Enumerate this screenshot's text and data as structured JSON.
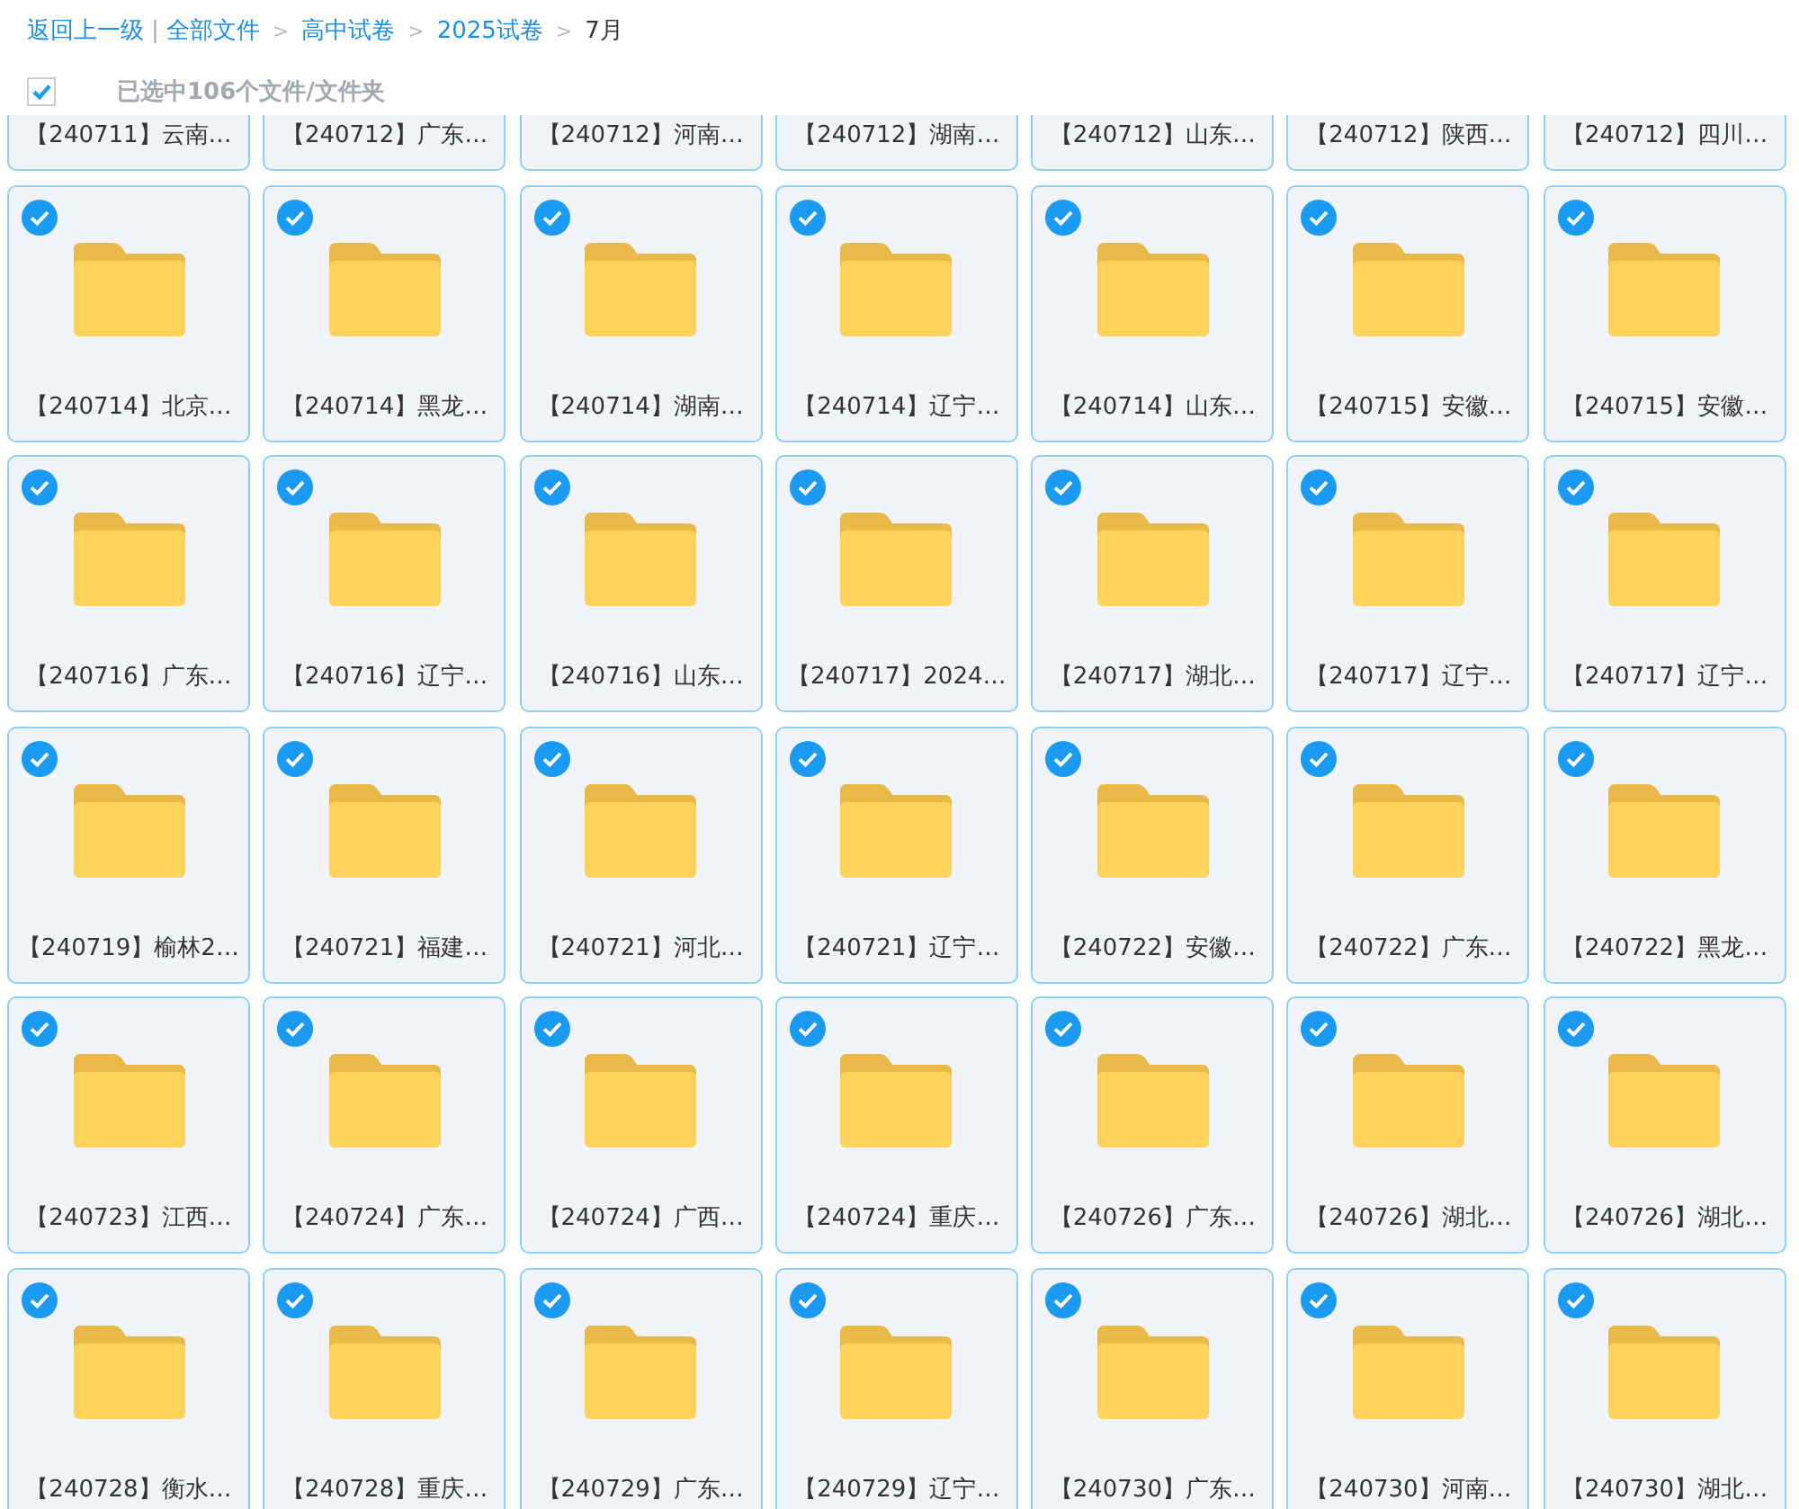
{
  "breadcrumb": {
    "back": "返回上一级",
    "separator": "|",
    "items": [
      {
        "label": "全部文件",
        "current": false
      },
      {
        "label": "高中试卷",
        "current": false
      },
      {
        "label": "2025试卷",
        "current": false
      },
      {
        "label": "7月",
        "current": true
      }
    ],
    "arrow": ">"
  },
  "selection_bar": {
    "checked": true,
    "label": "已选中106个文件/文件夹"
  },
  "files": [
    {
      "name": "【240711】云南…",
      "selected": true
    },
    {
      "name": "【240712】广东…",
      "selected": true
    },
    {
      "name": "【240712】河南…",
      "selected": true
    },
    {
      "name": "【240712】湖南…",
      "selected": true
    },
    {
      "name": "【240712】山东…",
      "selected": true
    },
    {
      "name": "【240712】陕西…",
      "selected": true
    },
    {
      "name": "【240712】四川…",
      "selected": true
    },
    {
      "name": "【240714】北京…",
      "selected": true
    },
    {
      "name": "【240714】黑龙…",
      "selected": true
    },
    {
      "name": "【240714】湖南…",
      "selected": true
    },
    {
      "name": "【240714】辽宁…",
      "selected": true
    },
    {
      "name": "【240714】山东…",
      "selected": true
    },
    {
      "name": "【240715】安徽…",
      "selected": true
    },
    {
      "name": "【240715】安徽…",
      "selected": true
    },
    {
      "name": "【240716】广东…",
      "selected": true
    },
    {
      "name": "【240716】辽宁…",
      "selected": true
    },
    {
      "name": "【240716】山东…",
      "selected": true
    },
    {
      "name": "【240717】2024…",
      "selected": true
    },
    {
      "name": "【240717】湖北…",
      "selected": true
    },
    {
      "name": "【240717】辽宁…",
      "selected": true
    },
    {
      "name": "【240717】辽宁…",
      "selected": true
    },
    {
      "name": "【240719】榆林2…",
      "selected": true
    },
    {
      "name": "【240721】福建…",
      "selected": true
    },
    {
      "name": "【240721】河北…",
      "selected": true
    },
    {
      "name": "【240721】辽宁…",
      "selected": true
    },
    {
      "name": "【240722】安徽…",
      "selected": true
    },
    {
      "name": "【240722】广东…",
      "selected": true
    },
    {
      "name": "【240722】黑龙…",
      "selected": true
    },
    {
      "name": "【240723】江西…",
      "selected": true
    },
    {
      "name": "【240724】广东…",
      "selected": true
    },
    {
      "name": "【240724】广西…",
      "selected": true
    },
    {
      "name": "【240724】重庆…",
      "selected": true
    },
    {
      "name": "【240726】广东…",
      "selected": true
    },
    {
      "name": "【240726】湖北…",
      "selected": true
    },
    {
      "name": "【240726】湖北…",
      "selected": true
    },
    {
      "name": "【240728】衡水…",
      "selected": true
    },
    {
      "name": "【240728】重庆…",
      "selected": true
    },
    {
      "name": "【240729】广东…",
      "selected": true
    },
    {
      "name": "【240729】辽宁…",
      "selected": true
    },
    {
      "name": "【240730】广东…",
      "selected": true
    },
    {
      "name": "【240730】河南…",
      "selected": true
    },
    {
      "name": "【240730】湖北…",
      "selected": true
    }
  ]
}
